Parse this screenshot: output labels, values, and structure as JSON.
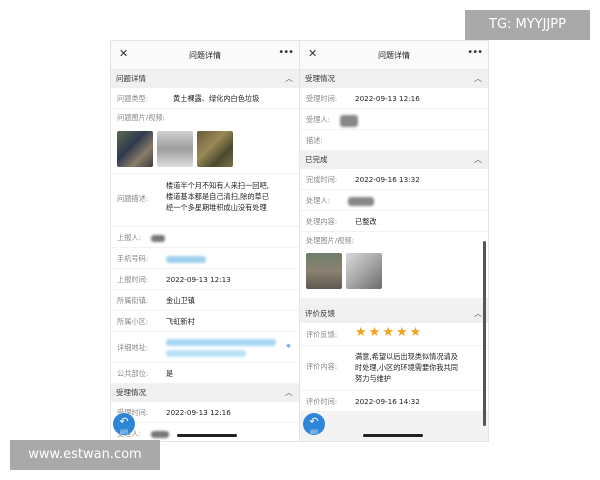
{
  "watermark_tg": "TG: MYYJJPP",
  "watermark_site": "www.estwan.com",
  "left": {
    "title": "问题详情",
    "close_icon": "close-icon",
    "more_icon": "more-icon",
    "section_problem": "问题详情",
    "type_label": "问题类型:",
    "type_value": "黄土裸露、绿化内白色垃圾",
    "images_label": "问题图片/视频:",
    "desc_label": "问题描述:",
    "desc_lines": [
      "楼道半个月不知有人来扫一回吧,",
      "楼道基本都是自己清扫,除的草已",
      "经一个多星期堆积成山没有处理"
    ],
    "reporter_label": "上报人:",
    "phone_label": "手机号码:",
    "report_time_label": "上报时间:",
    "report_time_value": "2022-09-13 12:13",
    "street_label": "所属街镇:",
    "street_value": "金山卫镇",
    "community_label": "所属小区:",
    "community_value": "飞虹新村",
    "address_label": "详细地址:",
    "public_label": "公共部位:",
    "public_value": "是",
    "section_accept": "受理情况",
    "accept_time_label": "受理时间:",
    "accept_time_value": "2022-09-13 12:16",
    "accept_person_label": "受理人:",
    "back_label": "返回"
  },
  "right": {
    "title": "问题详情",
    "section_accept": "受理情况",
    "accept_time_label": "受理时间:",
    "accept_time_value": "2022-09-13 12:16",
    "accept_person_label": "受理人:",
    "desc_label": "描述:",
    "section_done": "已完成",
    "done_time_label": "完成时间:",
    "done_time_value": "2022-09-16 13:32",
    "handler_label": "处理人:",
    "content_label": "处理内容:",
    "content_value": "已整改",
    "images_label": "处理图片/视频:",
    "section_eval": "评价反馈",
    "feedback_label": "评价反馈:",
    "rating": 5,
    "eval_content_label": "评价内容:",
    "eval_lines": [
      "满意,希望以后出现类似情况请及",
      "时处理,小区的环境需要你我共同",
      "努力与维护"
    ],
    "eval_time_label": "评价时间:",
    "eval_time_value": "2022-09-16 14:32",
    "back_label": "返回"
  }
}
